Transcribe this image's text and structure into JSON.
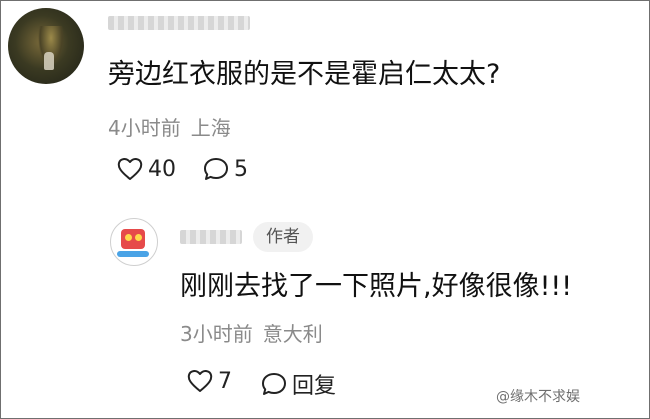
{
  "comment": {
    "text": "旁边红衣服的是不是霍启仁太太?",
    "time": "4小时前",
    "location": "上海",
    "likes": "40",
    "replies": "5"
  },
  "reply": {
    "badge": "作者",
    "text": "刚刚去找了一下照片,好像很像!!!",
    "time": "3小时前",
    "location": "意大利",
    "likes": "7",
    "reply_label": "回复"
  },
  "watermark": "@缘木不求娱",
  "icons": {
    "like": "heart-icon",
    "comment": "speech-bubble-icon"
  }
}
